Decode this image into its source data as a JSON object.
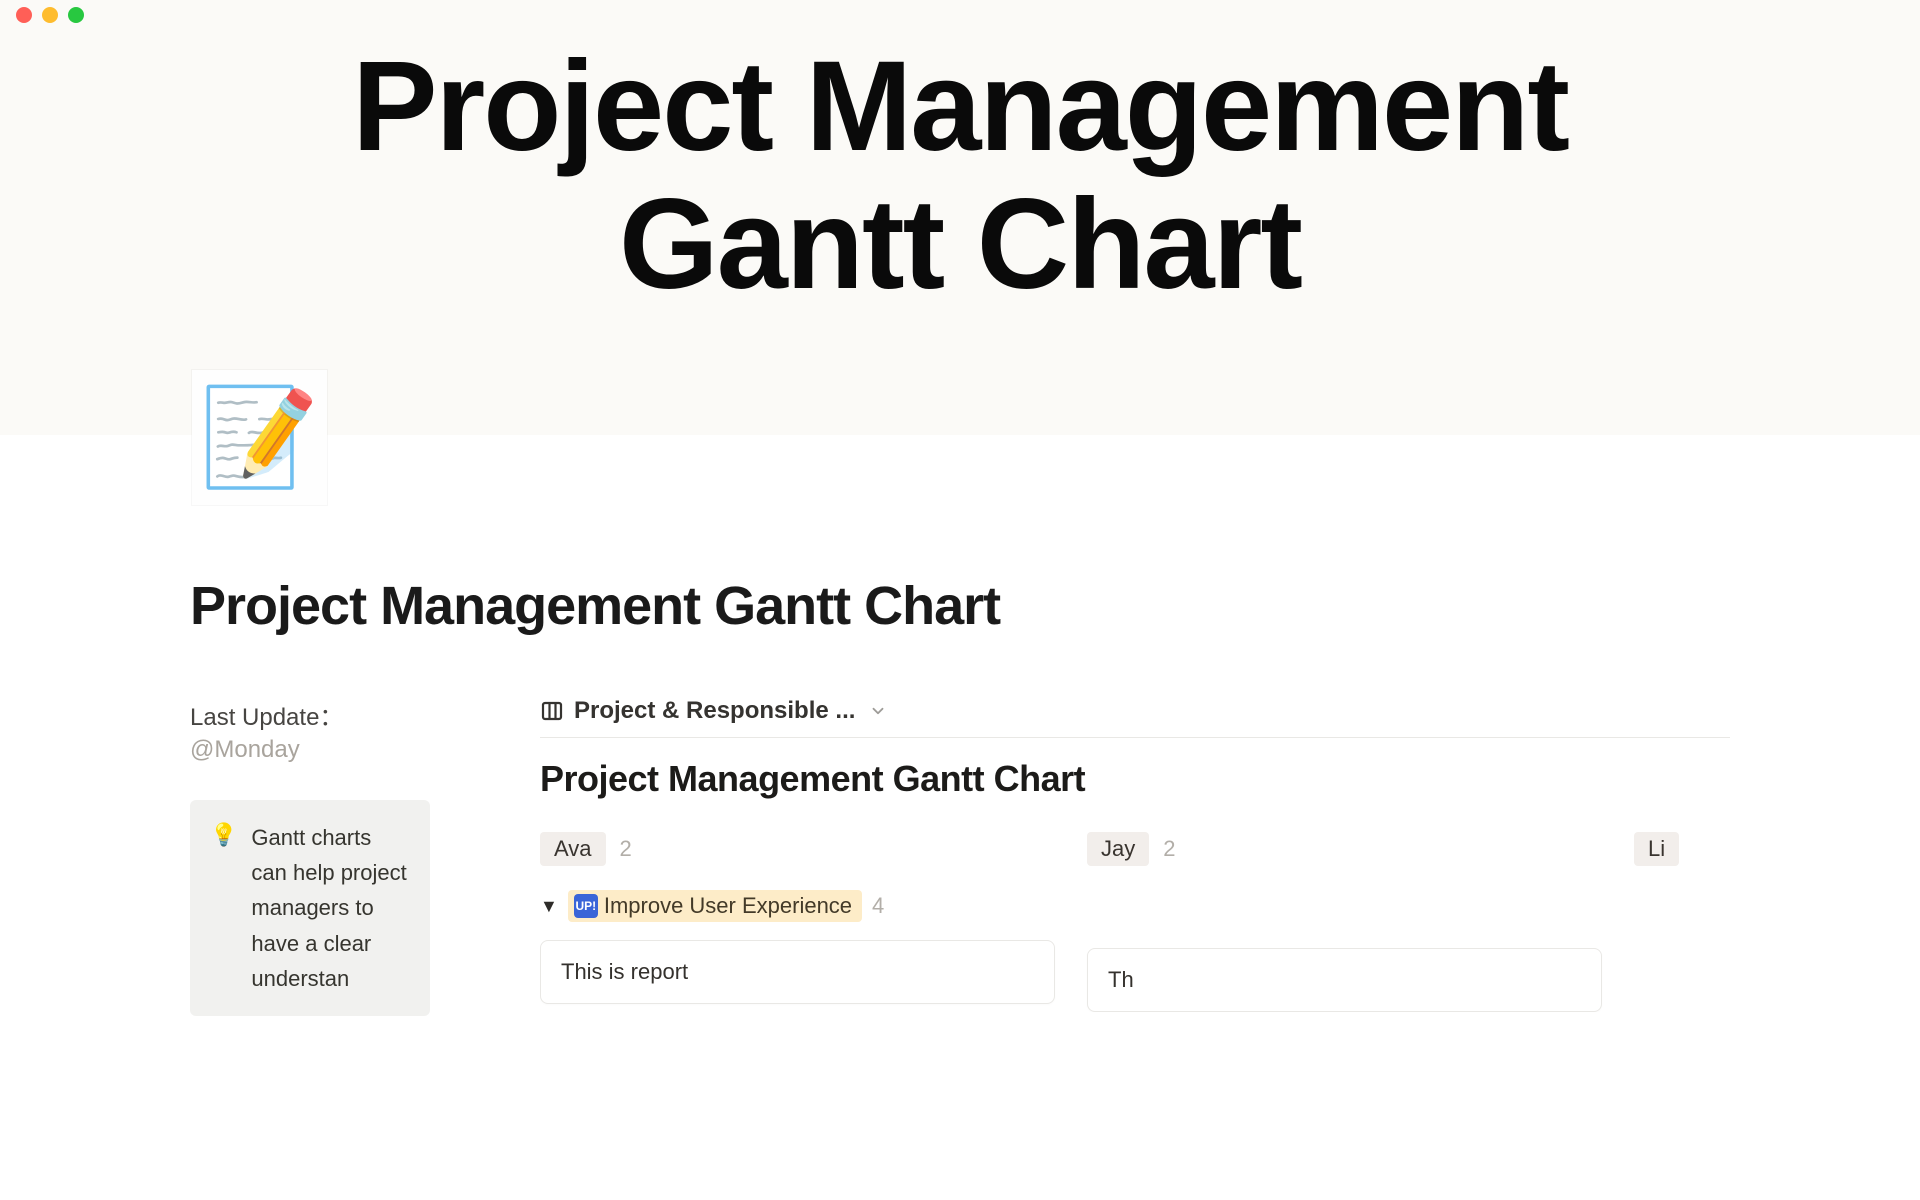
{
  "hero": {
    "title_line1": "Project Management",
    "title_line2": "Gantt Chart",
    "icon": "📝"
  },
  "page": {
    "title": "Project Management Gantt Chart"
  },
  "meta": {
    "label": "Last Update：",
    "value": "@Monday"
  },
  "callout": {
    "icon": "💡",
    "text": "Gantt charts can help project managers to have a clear understan"
  },
  "view": {
    "name": "Project & Responsible ..."
  },
  "database": {
    "title": "Project Management Gantt Chart"
  },
  "groups": [
    {
      "name": "Ava",
      "count": "2"
    },
    {
      "name": "Jay",
      "count": "2"
    },
    {
      "name": "Li"
    }
  ],
  "subgroup": {
    "emoji": "UP!",
    "name": "Improve User Experience",
    "count": "4"
  },
  "cards": [
    {
      "title": "This is report"
    },
    {
      "title": "Th"
    }
  ]
}
